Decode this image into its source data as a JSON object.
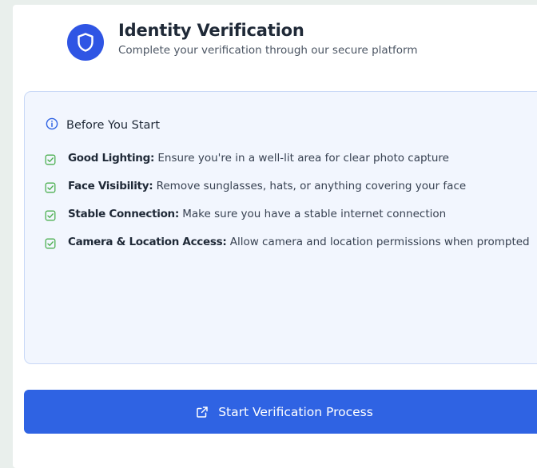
{
  "header": {
    "icon": "shield-icon",
    "title": "Identity Verification",
    "subtitle": "Complete your verification through our secure platform"
  },
  "before_start": {
    "icon": "info-icon",
    "heading": "Before You Start",
    "items": [
      {
        "icon": "check-square-icon",
        "title": "Good Lighting:",
        "text": " Ensure you're in a well-lit area for clear photo capture"
      },
      {
        "icon": "check-square-icon",
        "title": "Face Visibility:",
        "text": " Remove sunglasses, hats, or anything covering your face"
      },
      {
        "icon": "check-square-icon",
        "title": "Stable Connection:",
        "text": " Make sure you have a stable internet connection"
      },
      {
        "icon": "check-square-icon",
        "title": "Camera & Location Access:",
        "text": " Allow camera and location permissions when prompted"
      }
    ]
  },
  "action": {
    "icon": "external-link-icon",
    "label": "Start Verification Process"
  },
  "colors": {
    "background": "#e9efec",
    "primary": "#2f63e3",
    "badge": "#2f55e4",
    "info_bg": "#f2f6fe",
    "info_border": "#c8d8f7",
    "check": "#4caf50"
  }
}
